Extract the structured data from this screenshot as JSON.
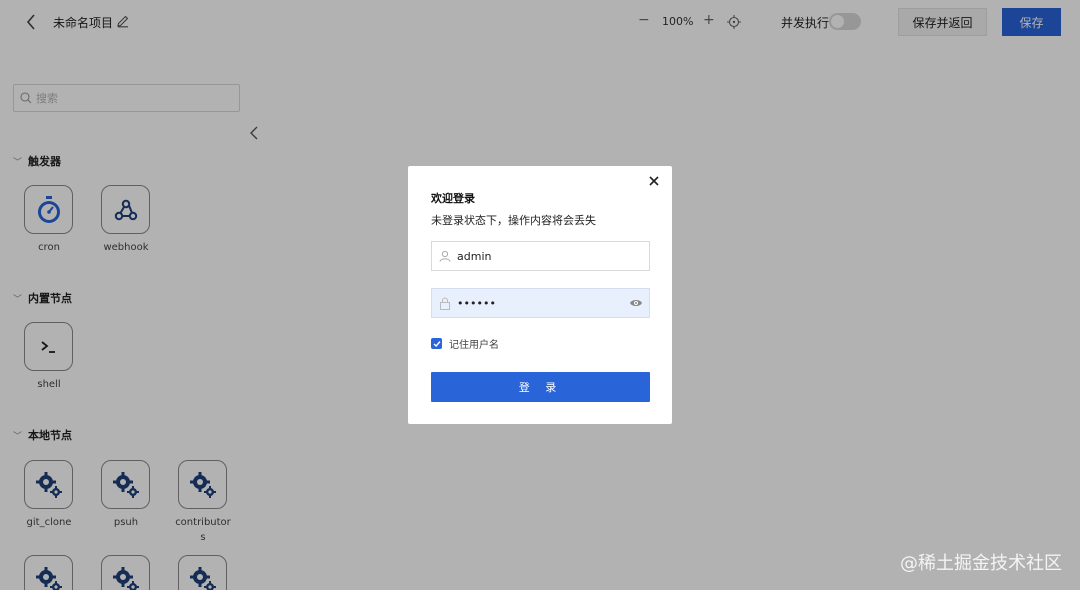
{
  "header": {
    "title": "未命名项目",
    "zoom_minus": "−",
    "zoom_value": "100%",
    "zoom_plus": "+",
    "concurrent_label": "并发执行",
    "concurrent_enabled": false,
    "save_return_label": "保存并返回",
    "save_label": "保存"
  },
  "sidebar": {
    "search_placeholder": "搜索",
    "sections": [
      {
        "title": "触发器",
        "nodes": [
          "cron",
          "webhook"
        ]
      },
      {
        "title": "内置节点",
        "nodes": [
          "shell"
        ]
      },
      {
        "title": "本地节点",
        "nodes": [
          "git_clone",
          "psuh",
          "contributors"
        ]
      }
    ]
  },
  "modal": {
    "title": "欢迎登录",
    "subtitle": "未登录状态下，操作内容将会丢失",
    "username": "admin",
    "password": "••••••",
    "remember_label": "记住用户名",
    "remember_checked": true,
    "login_label": "登 录"
  },
  "colors": {
    "primary": "#2a64d9",
    "overlay": "rgba(0,0,0,0.30)",
    "cron_icon": "#2a64d9",
    "node_icon": "#1f3f7a"
  },
  "watermark": "@稀土掘金技术社区"
}
